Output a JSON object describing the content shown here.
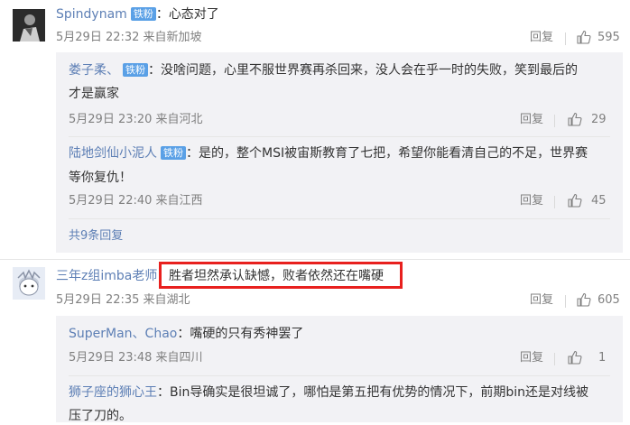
{
  "comments": [
    {
      "user": "Spindynam",
      "badge": "铁粉",
      "sep": "：",
      "text": "心态对了",
      "meta": "5月29日 22:32 来自新加坡",
      "reply_label": "回复",
      "likes": "595"
    },
    {
      "user": "三年z组imba老师",
      "sep": "：",
      "text": "胜者坦然承认缺憾，败者依然还在嘴硬",
      "meta": "5月29日 22:35 来自湖北",
      "reply_label": "回复",
      "likes": "605"
    }
  ],
  "replies_a": [
    {
      "user": "娄子柔、",
      "badge": "铁粉",
      "sep": "：",
      "text_line1": "没啥问题，心里不服世界赛再杀回来，没人会在乎一时的失败，笑到最后的",
      "text_line2": "才是赢家",
      "meta": "5月29日 23:20 来自河北",
      "reply_label": "回复",
      "likes": "29"
    },
    {
      "user": "陆地剑仙小泥人",
      "badge": "铁粉",
      "sep": "：",
      "text_line1": "是的，整个MSI被宙斯教育了七把，希望你能看清自己的不足，世界赛",
      "text_line2": "等你复仇！",
      "meta": "5月29日 22:40 来自江西",
      "reply_label": "回复",
      "likes": "45"
    }
  ],
  "more_replies": "共9条回复",
  "replies_b": [
    {
      "user": "SuperMan、Chao",
      "sep": "：",
      "text": "嘴硬的只有秀神罢了",
      "meta": "5月29日 23:48 来自四川",
      "reply_label": "回复",
      "likes": "1"
    },
    {
      "user": "狮子座的狮心王",
      "sep": "：",
      "text_line1": "Bin导确实是很坦诚了，哪怕是第五把有优势的情况下，前期bin还是对线被",
      "text_line2": "压了刀的。"
    }
  ],
  "icons": {
    "like": "thumbs-up-icon"
  },
  "colors": {
    "username_orange": "#eb7350",
    "username_blue": "#5d7fb5",
    "badge": "#5aa0e6",
    "highlight_border": "#e8201e"
  }
}
